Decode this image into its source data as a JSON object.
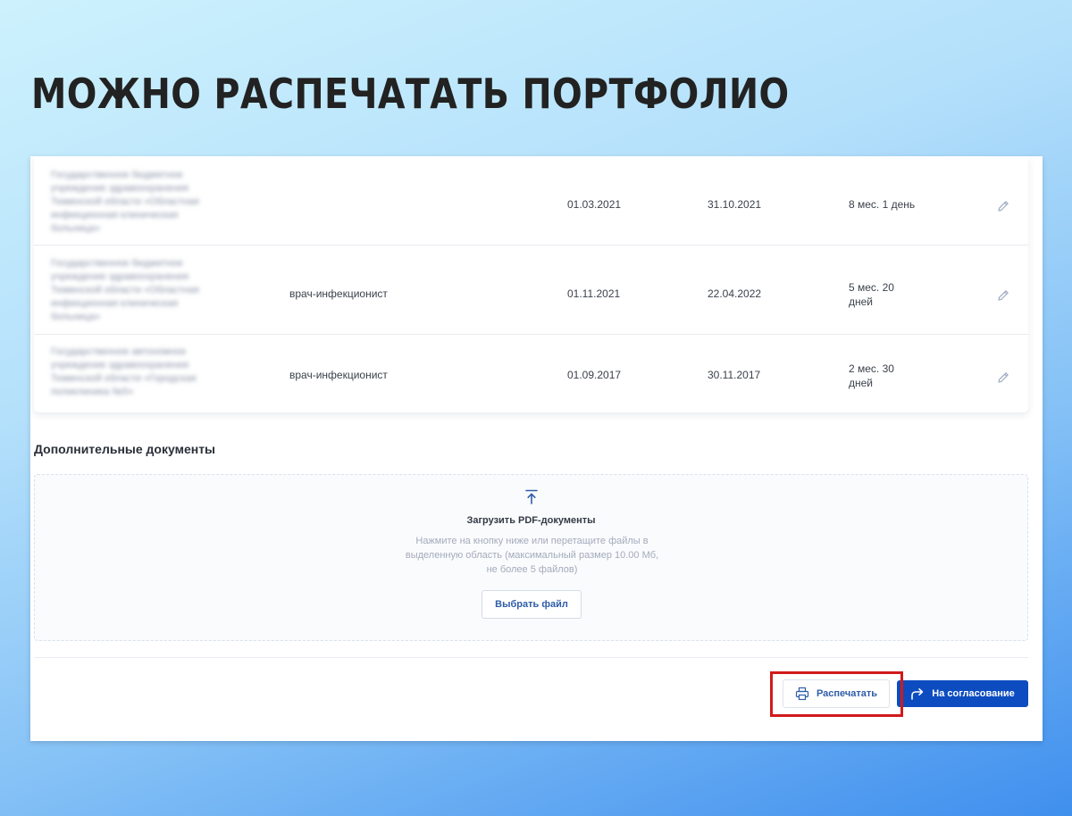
{
  "headline": "МОЖНО РАСПЕЧАТАТЬ ПОРТФОЛИО",
  "work_history": {
    "rows": [
      {
        "organization": "Государственное бюджетное учреждение здравоохранения Тюменской области «Областная инфекционная клиническая больница»",
        "position": "",
        "start": "01.03.2021",
        "end": "31.10.2021",
        "duration_line1": "8 мес. 1 день",
        "duration_line2": ""
      },
      {
        "organization": "Государственное бюджетное учреждение здравоохранения Тюменской области «Областная инфекционная клиническая больница»",
        "position": "врач-инфекционист",
        "start": "01.11.2021",
        "end": "22.04.2022",
        "duration_line1": "5 мес. 20",
        "duration_line2": "дней"
      },
      {
        "organization": "Государственное автономное учреждение здравоохранения Тюменской области «Городская поликлиника №5»",
        "position": "врач-инфекционист",
        "start": "01.09.2017",
        "end": "30.11.2017",
        "duration_line1": "2 мес. 30",
        "duration_line2": "дней"
      }
    ]
  },
  "additional_docs": {
    "title": "Дополнительные документы",
    "upload_title": "Загрузить PDF-документы",
    "hint_line1": "Нажмите на кнопку ниже или перетащите файлы в",
    "hint_line2": "выделенную область (максимальный размер 10.00 Мб,",
    "hint_line3": "не более 5 файлов)",
    "choose_button": "Выбрать файл"
  },
  "actions": {
    "print_label": "Распечатать",
    "approve_label": "На согласование"
  },
  "colors": {
    "primary": "#0d4cc0",
    "link": "#2f5da8",
    "highlight": "#d11a1a"
  }
}
